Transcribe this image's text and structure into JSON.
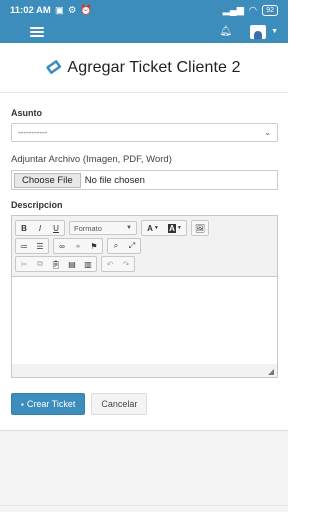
{
  "status_bar": {
    "time": "11:02 AM",
    "battery": "92"
  },
  "header": {
    "title": "Agregar Ticket Cliente 2"
  },
  "form": {
    "asunto_label": "Asunto",
    "asunto_value": "-----------",
    "file_label": "Adjuntar Archivo (Imagen, PDF, Word)",
    "file_button": "Choose File",
    "file_status": "No file chosen",
    "descripcion_label": "Descripcion",
    "format_dropdown": "Formato"
  },
  "editor": {
    "bold": "B",
    "italic": "I",
    "underline": "U",
    "font_color": "A",
    "bg_color": "A"
  },
  "actions": {
    "create_label": "Crear Ticket",
    "cancel_label": "Cancelar"
  },
  "colors": {
    "primary": "#3c8dbc"
  }
}
